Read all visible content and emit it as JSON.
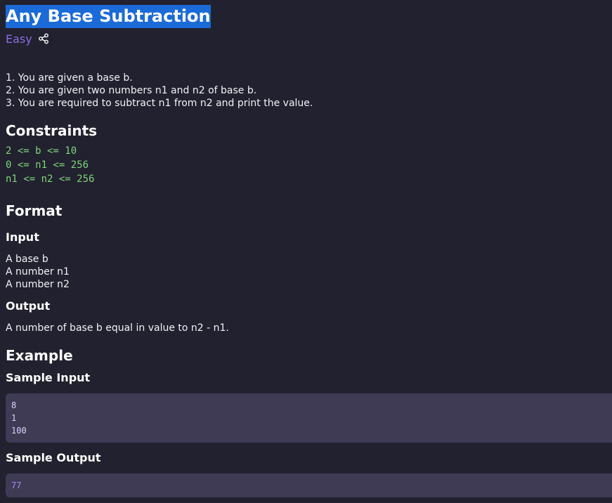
{
  "problem": {
    "title": "Any Base Subtraction",
    "difficulty": "Easy",
    "share_icon": "share-icon"
  },
  "statement": [
    "1. You are given a base b.",
    "2. You are given two numbers n1 and n2 of base b.",
    "3. You are required to subtract n1 from n2 and print the value."
  ],
  "constraints": {
    "heading": "Constraints",
    "lines": [
      "2 <= b <= 10",
      "0 <= n1 <= 256",
      "n1 <= n2 <= 256"
    ]
  },
  "format": {
    "heading": "Format",
    "input_heading": "Input",
    "input_lines": [
      "A base b",
      "A number n1",
      "A number n2"
    ],
    "output_heading": "Output",
    "output_text": "A number of base b equal in value to n2 - n1."
  },
  "example": {
    "heading": "Example",
    "sample_input_heading": "Sample Input",
    "sample_input_lines": [
      "8",
      "1",
      "100"
    ],
    "sample_output_heading": "Sample Output",
    "sample_output_lines": [
      "77"
    ]
  },
  "colors": {
    "background": "#22212f",
    "title_highlight": "#1a6ad8",
    "difficulty": "#8b6ce0",
    "constraints_text": "#7fd47c",
    "code_background": "#3f3b55"
  }
}
